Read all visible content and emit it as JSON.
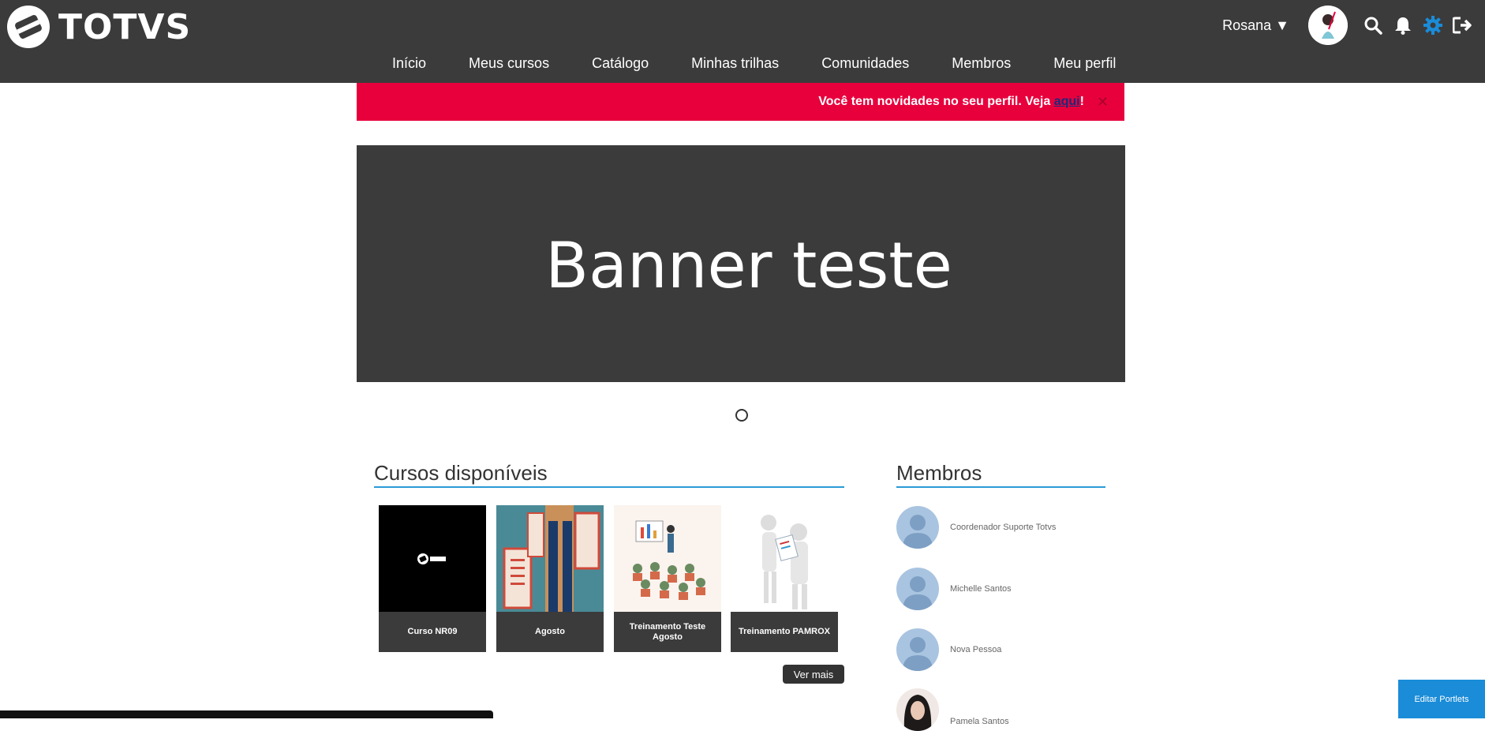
{
  "header": {
    "brand": "TOTVS",
    "user_name": "Rosana ▼",
    "icons": [
      "search-icon",
      "bell-icon",
      "gear-icon",
      "logout-icon"
    ],
    "accent_color": "#2a9ad6"
  },
  "nav": {
    "items": [
      "Início",
      "Meus cursos",
      "Catálogo",
      "Minhas trilhas",
      "Comunidades",
      "Membros",
      "Meu perfil"
    ]
  },
  "alert": {
    "text": "Você tem novidades no seu perfil. Veja ",
    "link": "aqui",
    "suffix": "!",
    "close": "✕",
    "color": "#e8003d"
  },
  "banner": {
    "title": "Banner teste"
  },
  "courses": {
    "title": "Cursos disponíveis",
    "items": [
      {
        "title": "Curso NR09"
      },
      {
        "title": "Agosto"
      },
      {
        "title": "Treinamento Teste Agosto"
      },
      {
        "title": "Treinamento PAMROX"
      }
    ],
    "more": "Ver mais"
  },
  "members": {
    "title": "Membros",
    "items": [
      {
        "name": "Coordenador Suporte Totvs"
      },
      {
        "name": "Michelle Santos"
      },
      {
        "name": "Nova Pessoa"
      },
      {
        "name": "Pamela Santos"
      }
    ]
  },
  "footer": {
    "edit_portlets": "Editar Portlets"
  }
}
